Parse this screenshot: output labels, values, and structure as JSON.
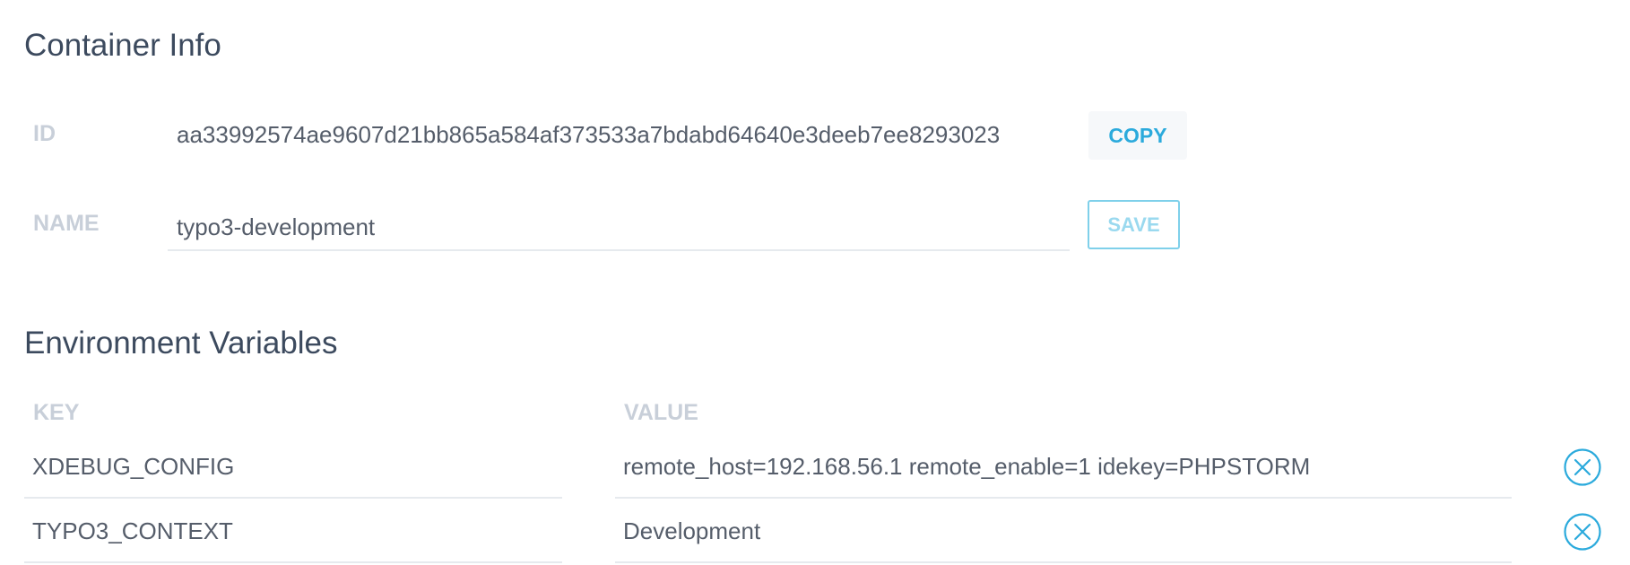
{
  "container_info": {
    "title": "Container Info",
    "id_label": "ID",
    "id_value": "aa33992574ae9607d21bb865a584af373533a7bdabd64640e3deeb7ee8293023",
    "copy_label": "COPY",
    "name_label": "NAME",
    "name_value": "typo3-development",
    "save_label": "SAVE"
  },
  "environment": {
    "title": "Environment Variables",
    "key_header": "KEY",
    "value_header": "VALUE",
    "rows": [
      {
        "key": "XDEBUG_CONFIG",
        "value": "remote_host=192.168.56.1 remote_enable=1 idekey=PHPSTORM"
      },
      {
        "key": "TYPO3_CONTEXT",
        "value": "Development"
      }
    ]
  },
  "colors": {
    "accent": "#2baadc",
    "label": "#c8cfd9",
    "title": "#3c4a5e",
    "divider": "#e6eaee"
  },
  "icons": {
    "remove": "circle-x-icon"
  }
}
